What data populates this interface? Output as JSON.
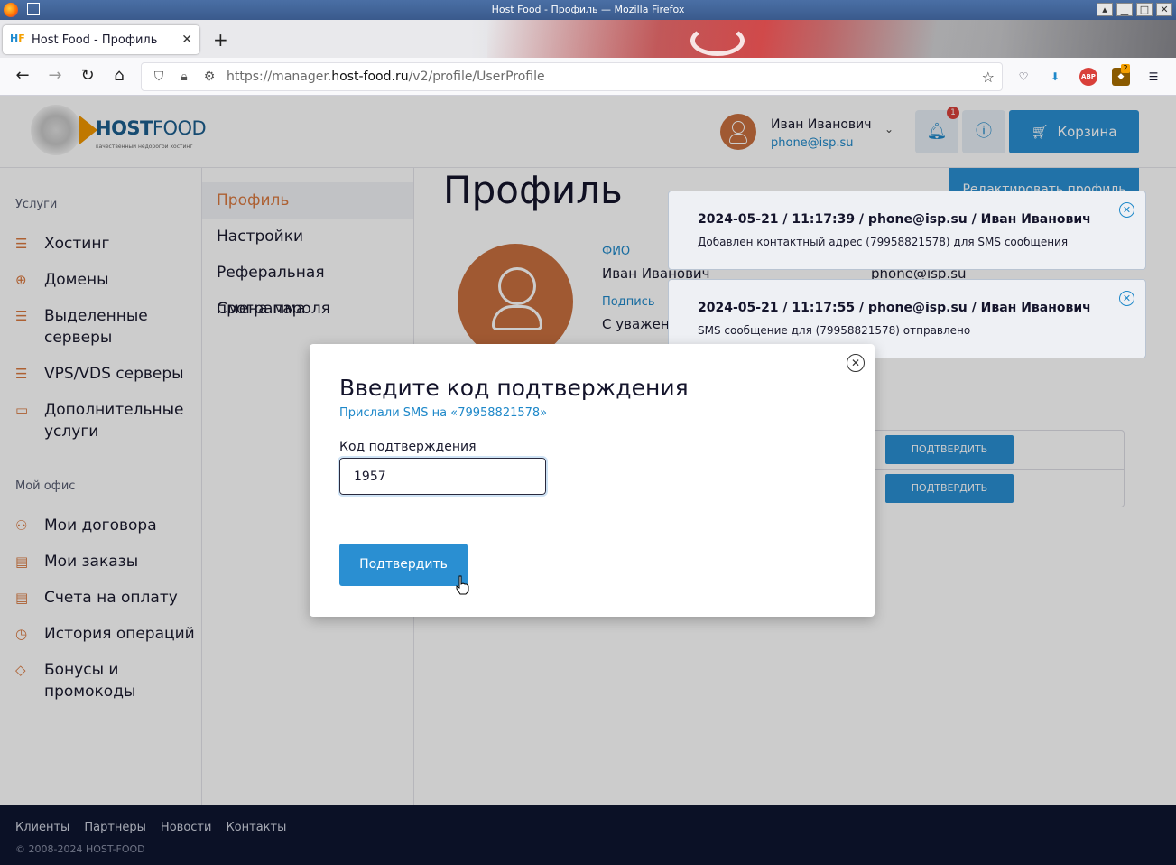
{
  "window": {
    "title": "Host Food - Профиль — Mozilla Firefox"
  },
  "browser": {
    "tab_title": "Host Food - Профиль",
    "url_host_prefix": "https://manager.",
    "url_domain": "host-food.ru",
    "url_path": "/v2/profile/UserProfile",
    "ext_abp": "ABP",
    "ext_badge": "2"
  },
  "header": {
    "logo_bold": "HOST",
    "logo_light": "FOOD",
    "logo_tagline": "качественный недорогой хостинг",
    "user_name": "Иван Иванович",
    "user_phone": "phone@isp.su",
    "notif_count": "1",
    "cart_label": "Корзина"
  },
  "sidebar": {
    "group1": "Услуги",
    "items1": [
      {
        "label": "Хостинг",
        "icon": "server-icon"
      },
      {
        "label": "Домены",
        "icon": "globe-icon"
      },
      {
        "label": "Выделенные серверы",
        "icon": "dedicated-server-icon"
      },
      {
        "label": "VPS/VDS серверы",
        "icon": "vps-icon"
      },
      {
        "label": "Дополнительные услуги",
        "icon": "extra-services-icon"
      }
    ],
    "group2": "Мой офис",
    "items2": [
      {
        "label": "Мои договора",
        "icon": "contracts-icon"
      },
      {
        "label": "Мои заказы",
        "icon": "orders-icon"
      },
      {
        "label": "Счета на оплату",
        "icon": "invoices-icon"
      },
      {
        "label": "История операций",
        "icon": "history-icon"
      },
      {
        "label": "Бонусы и промокоды",
        "icon": "tag-icon"
      }
    ]
  },
  "subnav": {
    "items": [
      "Профиль",
      "Настройки",
      "Реферальная программа",
      "Смена пароля"
    ]
  },
  "main": {
    "title": "Профиль",
    "edit_button": "Редактировать профиль",
    "fio_label": "ФИО",
    "fio_value": "Иван Иванович",
    "email_value": "phone@isp.su",
    "signature_label": "Подпись",
    "signature_value": "С уважени",
    "confirm_small": "ПОДТВЕРДИТЬ"
  },
  "toasts": [
    {
      "header": "2024-05-21 / 11:17:39 / phone@isp.su / Иван Иванович",
      "body": "Добавлен контактный адрес (79958821578) для SMS сообщения"
    },
    {
      "header": "2024-05-21 / 11:17:55 / phone@isp.su / Иван Иванович",
      "body": "SMS сообщение для (79958821578) отправлено"
    }
  ],
  "modal": {
    "title": "Введите код подтверждения",
    "subtitle": "Прислали SMS на «79958821578»",
    "field_label": "Код подтверждения",
    "field_value": "1957",
    "submit_label": "Подтвердить"
  },
  "footer": {
    "links": [
      "Клиенты",
      "Партнеры",
      "Новости",
      "Контакты"
    ],
    "copyright": "© 2008-2024 HOST-FOOD"
  },
  "colors": {
    "accent": "#2a8fd2",
    "orange": "#d9783f",
    "footer_bg": "#0e1630"
  }
}
